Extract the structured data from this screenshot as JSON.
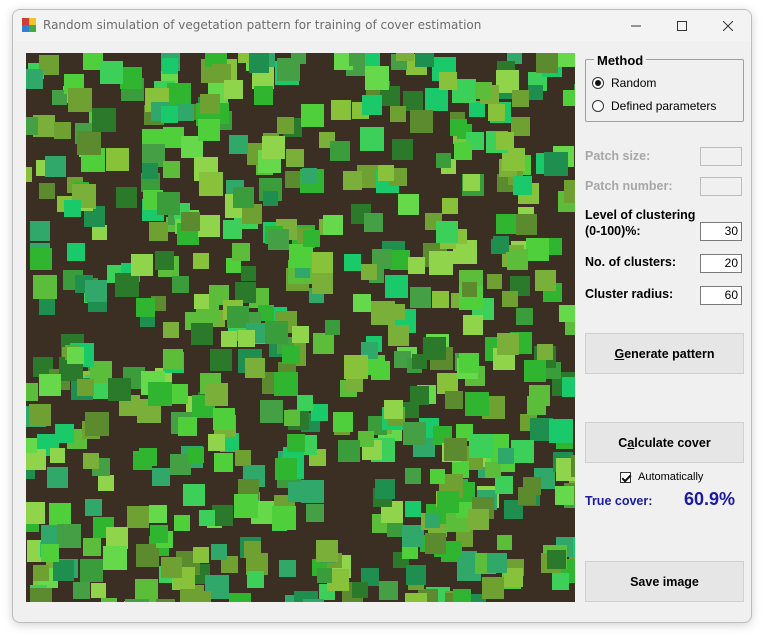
{
  "window": {
    "title": "Random simulation of vegetation pattern for training of cover estimation",
    "soil_color": "#3b2e22"
  },
  "method": {
    "legend": "Method",
    "options": [
      {
        "label": "Random",
        "selected": true
      },
      {
        "label": "Defined parameters",
        "selected": false
      }
    ]
  },
  "params": {
    "patch_size": {
      "label": "Patch size:",
      "value": "",
      "enabled": false
    },
    "patch_number": {
      "label": "Patch number:",
      "value": "",
      "enabled": false
    },
    "clustering": {
      "label_line1": "Level of clustering",
      "label_line2": "(0-100)%:",
      "value": "30"
    },
    "clusters": {
      "label": "No. of clusters:",
      "value": "20"
    },
    "radius": {
      "label": "Cluster radius:",
      "value": "60"
    }
  },
  "buttons": {
    "generate": {
      "prefix": "",
      "mnemonic": "G",
      "rest": "enerate pattern"
    },
    "calculate": {
      "prefix": "C",
      "mnemonic": "a",
      "rest": "lculate cover"
    },
    "save": {
      "label": "Save image"
    }
  },
  "auto": {
    "label": "Automatically",
    "checked": true
  },
  "cover": {
    "label": "True cover:",
    "value": "60.9%"
  },
  "palette": [
    "#2fb52f",
    "#4fcf3a",
    "#65d94a",
    "#3a9c3a",
    "#1f8f4f",
    "#2fa86a",
    "#5bbd3a",
    "#7ab03a",
    "#88c23a",
    "#45a045",
    "#19c96a",
    "#3cd05a",
    "#5c8a2e",
    "#6fa032",
    "#2b7a2b",
    "#8fd44a"
  ]
}
